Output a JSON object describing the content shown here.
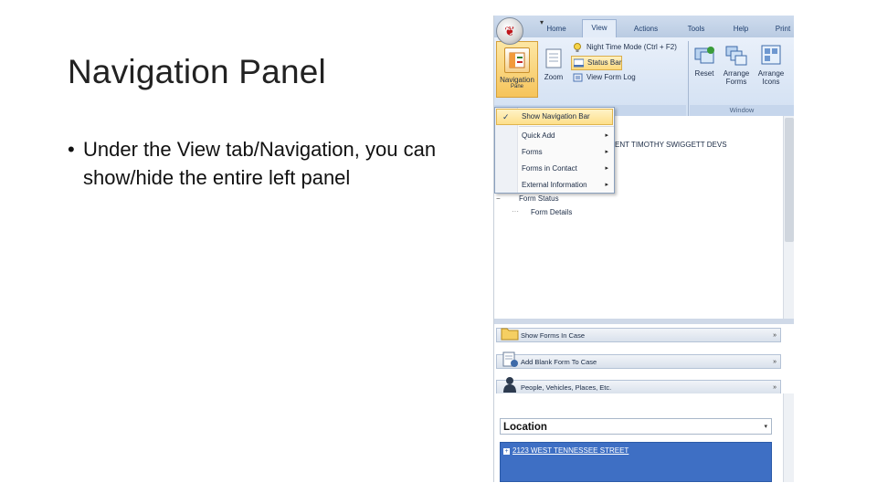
{
  "slide": {
    "title": "Navigation Panel",
    "bullet_glyph": "•",
    "bullet": "Under the View tab/Navigation, you can show/hide the entire left panel"
  },
  "app": {
    "tabs": [
      "Home",
      "View",
      "Actions",
      "Tools",
      "Help",
      "Print"
    ],
    "active_tab": "View",
    "ribbon": {
      "navigation_label": "Navigation",
      "navigation_sub": "Pane",
      "zoom_label": "Zoom",
      "commands": [
        "Night Time Mode (Ctrl + F2)",
        "Status Bar",
        "View Form Log"
      ],
      "window_buttons": [
        "Reset",
        "Arrange Forms",
        "Arrange Icons"
      ],
      "window_group_label": "Window"
    },
    "nav_menu": {
      "items": [
        "Show Navigation Bar",
        "Quick Add",
        "Forms",
        "Forms in Contact",
        "External Information"
      ],
      "checked": "✓",
      "submenu_arrow": "▸"
    },
    "content": {
      "header_text": "ENT TIMOTHY SWIGGETT DEVS",
      "tree_root": "Form Status",
      "tree_child": "Form Details",
      "tree_toggle": "−"
    },
    "panels": {
      "show_forms": "Show Forms In Case",
      "add_blank_form": "Add Blank Form To Case",
      "people": "People, Vehicles, Places, Etc.",
      "expand_glyph": "»"
    },
    "location": {
      "label": "Location",
      "dropdown_glyph": "▾",
      "selected_row": "2123 WEST TENNESSEE STREET",
      "row_plus": "+"
    },
    "colors": {
      "accent_blue": "#3e6fc4",
      "highlight_gold": "#fcd97d",
      "app_red": "#c0161b"
    }
  }
}
